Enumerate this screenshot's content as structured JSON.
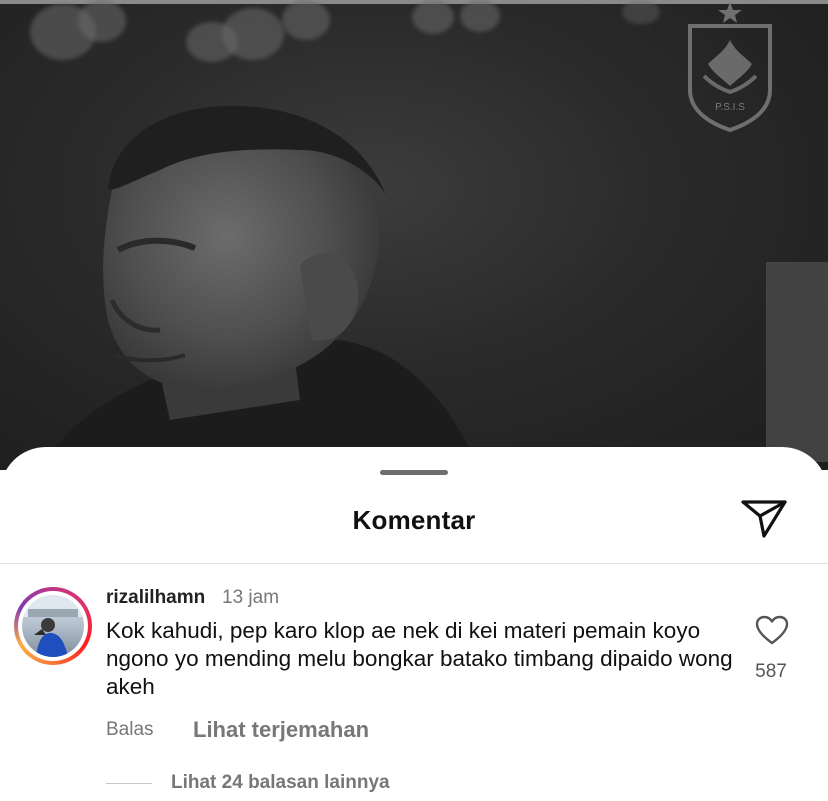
{
  "photo": {
    "crest_icon": "psis-club-crest-icon",
    "crest_text": "P.S.I.S"
  },
  "sheet": {
    "title": "Komentar",
    "send_icon": "send-paper-plane-icon"
  },
  "comment": {
    "username": "rizalilhamn",
    "time": "13 jam",
    "text": "Kok kahudi, pep karo klop ae nek di kei materi pemain koyo ngono yo mending melu bongkar batako timbang dipaido wong akeh",
    "likes": "587",
    "reply_label": "Balas",
    "translate_label": "Lihat terjemahan",
    "view_replies_label": "Lihat 24 balasan lainnya",
    "avatar_story_ring": true
  },
  "colors": {
    "sheet_bg": "#ffffff",
    "text_primary": "#111111",
    "text_secondary": "#777777",
    "story_ring": [
      "#833ab4",
      "#fd1d1d",
      "#fcaf45"
    ]
  }
}
